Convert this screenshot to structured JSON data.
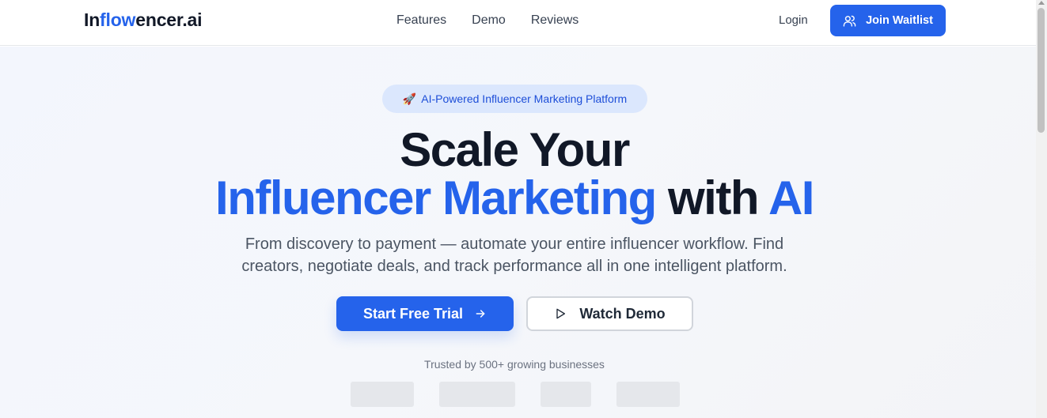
{
  "brand": {
    "prefix": "In",
    "accent": "flow",
    "suffix": "encer.ai",
    "accent_color": "#2563eb"
  },
  "nav": {
    "links": [
      "Features",
      "Demo",
      "Reviews"
    ],
    "login": "Login",
    "cta": "Join Waitlist",
    "cta_icon": "users-icon"
  },
  "hero": {
    "badge_icon": "🚀",
    "badge": "AI-Powered Influencer Marketing Platform",
    "headline_line1": "Scale Your",
    "headline_blue1": "Influencer Marketing",
    "headline_mid": "with",
    "headline_blue2": "AI",
    "subtitle": "From discovery to payment — automate your entire influencer workflow. Find creators, negotiate deals, and track performance all in one intelligent platform.",
    "primary_cta": "Start Free Trial",
    "primary_icon": "arrow-right-icon",
    "secondary_cta": "Watch Demo",
    "secondary_icon": "play-icon",
    "trusted": "Trusted by 500+ growing businesses"
  }
}
